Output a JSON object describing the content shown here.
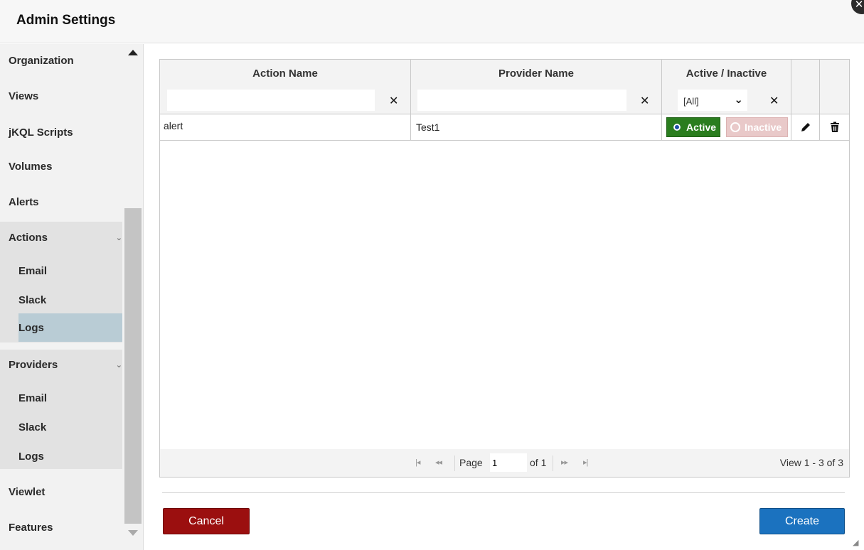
{
  "header": {
    "title": "Admin Settings",
    "close_icon": "close-icon"
  },
  "sidebar": {
    "items": [
      {
        "label": "Organization"
      },
      {
        "label": "Views"
      },
      {
        "label": "jKQL Scripts"
      },
      {
        "label": "Volumes"
      },
      {
        "label": "Alerts"
      },
      {
        "label": "Actions",
        "expanded": true
      },
      {
        "label": "Email"
      },
      {
        "label": "Slack"
      },
      {
        "label": "Logs",
        "selected": true
      },
      {
        "label": "Providers",
        "expanded": true
      },
      {
        "label": "Email"
      },
      {
        "label": "Slack"
      },
      {
        "label": "Logs"
      },
      {
        "label": "Viewlet"
      },
      {
        "label": "Features"
      }
    ],
    "chevron": "⌄"
  },
  "grid": {
    "columns": [
      "Action Name",
      "Provider Name",
      "Active / Inactive"
    ],
    "filters": {
      "action_name": "",
      "provider_name": "",
      "status": "[All]"
    },
    "clear_symbol": "✕",
    "rows": [
      {
        "action_name": "alert",
        "provider_name": "Test1",
        "active_label": "Active",
        "inactive_label": "Inactive"
      }
    ],
    "pager": {
      "page_label": "Page",
      "page_value": "1",
      "of_label": "of 1",
      "view_text": "View 1 - 3 of 3"
    }
  },
  "footer": {
    "cancel_label": "Cancel",
    "create_label": "Create"
  },
  "colors": {
    "active": "#2a7d1e",
    "inactive": "#e9c9c9",
    "cancel": "#9b0f0f",
    "create": "#1b72bf",
    "selected": "#b9ccd5"
  }
}
